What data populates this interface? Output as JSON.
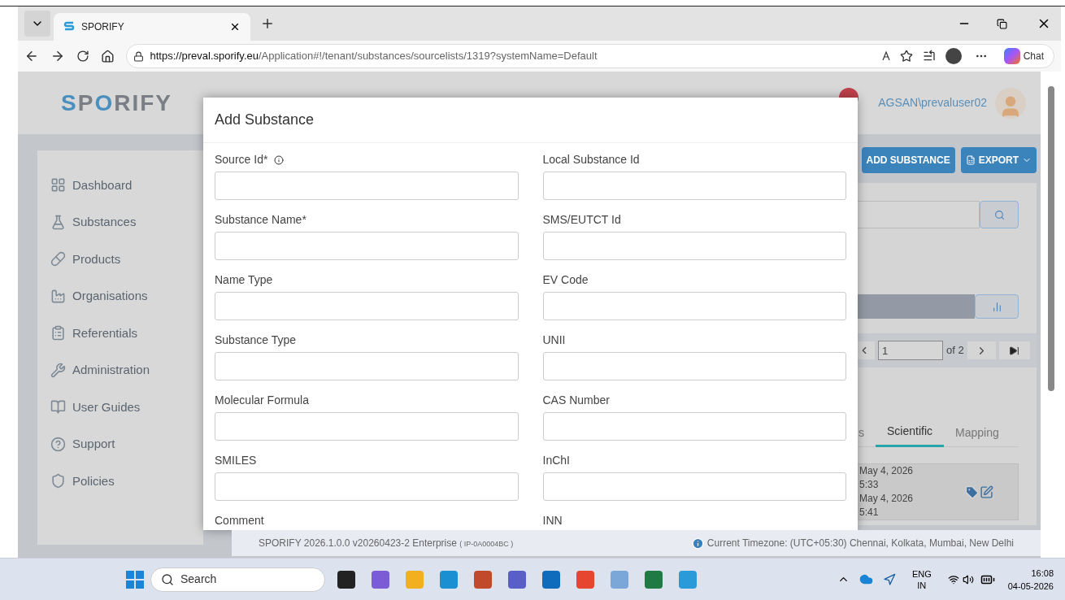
{
  "browser": {
    "tab": {
      "title": "SPORIFY",
      "selected": true
    },
    "url": {
      "host": "https://preval.sporify.eu",
      "path": "/Application#!/tenant/substances/sourcelists/1319?systemName=Default"
    },
    "chat_button": "Chat"
  },
  "app": {
    "logo": "SPORIFY",
    "user": "AGSAN\\prevaluser02"
  },
  "sidebar": {
    "items": [
      {
        "label": "Dashboard"
      },
      {
        "label": "Substances"
      },
      {
        "label": "Products"
      },
      {
        "label": "Organisations"
      },
      {
        "label": "Referentials"
      },
      {
        "label": "Administration"
      },
      {
        "label": "User Guides"
      },
      {
        "label": "Support"
      },
      {
        "label": "Policies"
      }
    ]
  },
  "toolbar": {
    "buttons": [
      {
        "label": "ADD SUBSTANCE",
        "kind": "plain"
      },
      {
        "label": "EXPORT",
        "kind": "dropdown"
      }
    ]
  },
  "pagination": {
    "page": "1",
    "of": "of 2"
  },
  "detail_tabs": [
    {
      "label": "s",
      "selected": false
    },
    {
      "label": "Scientific",
      "selected": true
    },
    {
      "label": "Mapping",
      "selected": false
    }
  ],
  "record": {
    "lines": [
      "May 4, 2026",
      "5:33",
      "May 4, 2026",
      "5:41"
    ]
  },
  "modal": {
    "title": "Add Substance",
    "fields": [
      {
        "label": "Source Id*",
        "kind": "info"
      },
      {
        "label": "Local Substance Id",
        "kind": "plain"
      },
      {
        "label": "Substance Name*",
        "kind": "plain"
      },
      {
        "label": "SMS/EUTCT Id",
        "kind": "plain"
      },
      {
        "label": "Name Type",
        "kind": "plain"
      },
      {
        "label": "EV Code",
        "kind": "plain"
      },
      {
        "label": "Substance Type",
        "kind": "plain"
      },
      {
        "label": "UNII",
        "kind": "plain"
      },
      {
        "label": "Molecular Formula",
        "kind": "plain"
      },
      {
        "label": "CAS Number",
        "kind": "plain"
      },
      {
        "label": "SMILES",
        "kind": "plain"
      },
      {
        "label": "InChI",
        "kind": "plain"
      },
      {
        "label": "Comment",
        "kind": "cut"
      },
      {
        "label": "INN",
        "kind": "cut"
      }
    ]
  },
  "footer": {
    "version": "SPORIFY 2026.1.0.0 v20260423-2 Enterprise",
    "build": "( IP-0A0004BC )",
    "timezone": "Current Timezone: (UTC+05:30) Chennai, Kolkata, Mumbai, New Delhi"
  },
  "taskbar": {
    "search": "Search",
    "language": "ENG",
    "region": "IN",
    "time": "16:08",
    "date": "04-05-2026"
  }
}
